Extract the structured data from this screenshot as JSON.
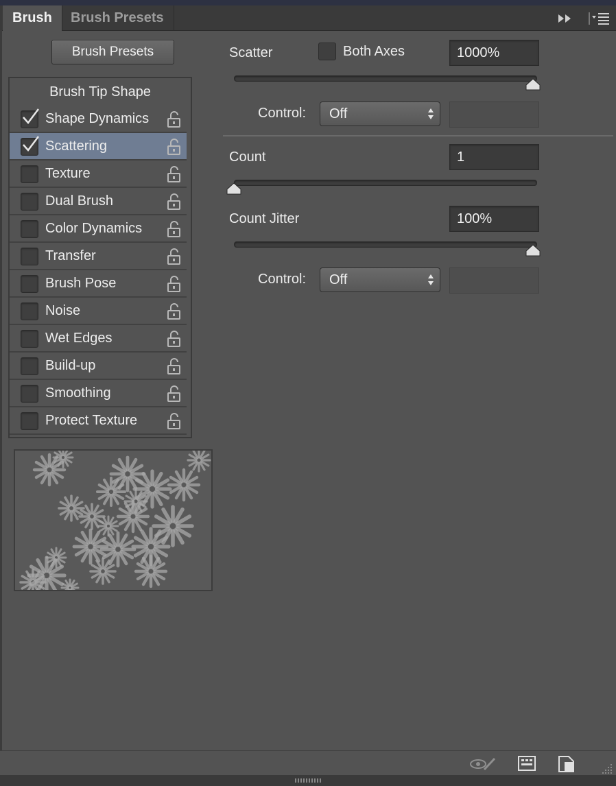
{
  "tabs": [
    {
      "label": "Brush",
      "active": true
    },
    {
      "label": "Brush Presets",
      "active": false
    }
  ],
  "presets_button": "Brush Presets",
  "tip_shape_label": "Brush Tip Shape",
  "options": [
    {
      "label": "Shape Dynamics",
      "checked": true,
      "selected": false
    },
    {
      "label": "Scattering",
      "checked": true,
      "selected": true
    },
    {
      "label": "Texture",
      "checked": false,
      "selected": false
    },
    {
      "label": "Dual Brush",
      "checked": false,
      "selected": false
    },
    {
      "label": "Color Dynamics",
      "checked": false,
      "selected": false
    },
    {
      "label": "Transfer",
      "checked": false,
      "selected": false
    },
    {
      "label": "Brush Pose",
      "checked": false,
      "selected": false
    },
    {
      "label": "Noise",
      "checked": false,
      "selected": false
    },
    {
      "label": "Wet Edges",
      "checked": false,
      "selected": false
    },
    {
      "label": "Build-up",
      "checked": false,
      "selected": false
    },
    {
      "label": "Smoothing",
      "checked": false,
      "selected": false
    },
    {
      "label": "Protect Texture",
      "checked": false,
      "selected": false
    }
  ],
  "scatter": {
    "label": "Scatter",
    "both_axes_label": "Both Axes",
    "both_axes_checked": false,
    "value": "1000%",
    "slider_fraction": 1.0,
    "control_label": "Control:",
    "control_value": "Off"
  },
  "count": {
    "label": "Count",
    "value": "1",
    "slider_fraction": 0.0
  },
  "count_jitter": {
    "label": "Count Jitter",
    "value": "100%",
    "slider_fraction": 1.0,
    "control_label": "Control:",
    "control_value": "Off"
  },
  "colors": {
    "panel_bg": "#535353",
    "selected_row": "#6f7d93",
    "tab_bar": "#3a3a3a"
  },
  "icons": {
    "collapse": "double-chevron-right-icon",
    "menu": "panel-menu-icon",
    "lock": "unlocked-padlock-icon",
    "bottom": [
      "eye-brush-icon",
      "grid-icon",
      "new-page-icon",
      "resize-grip-icon"
    ]
  }
}
